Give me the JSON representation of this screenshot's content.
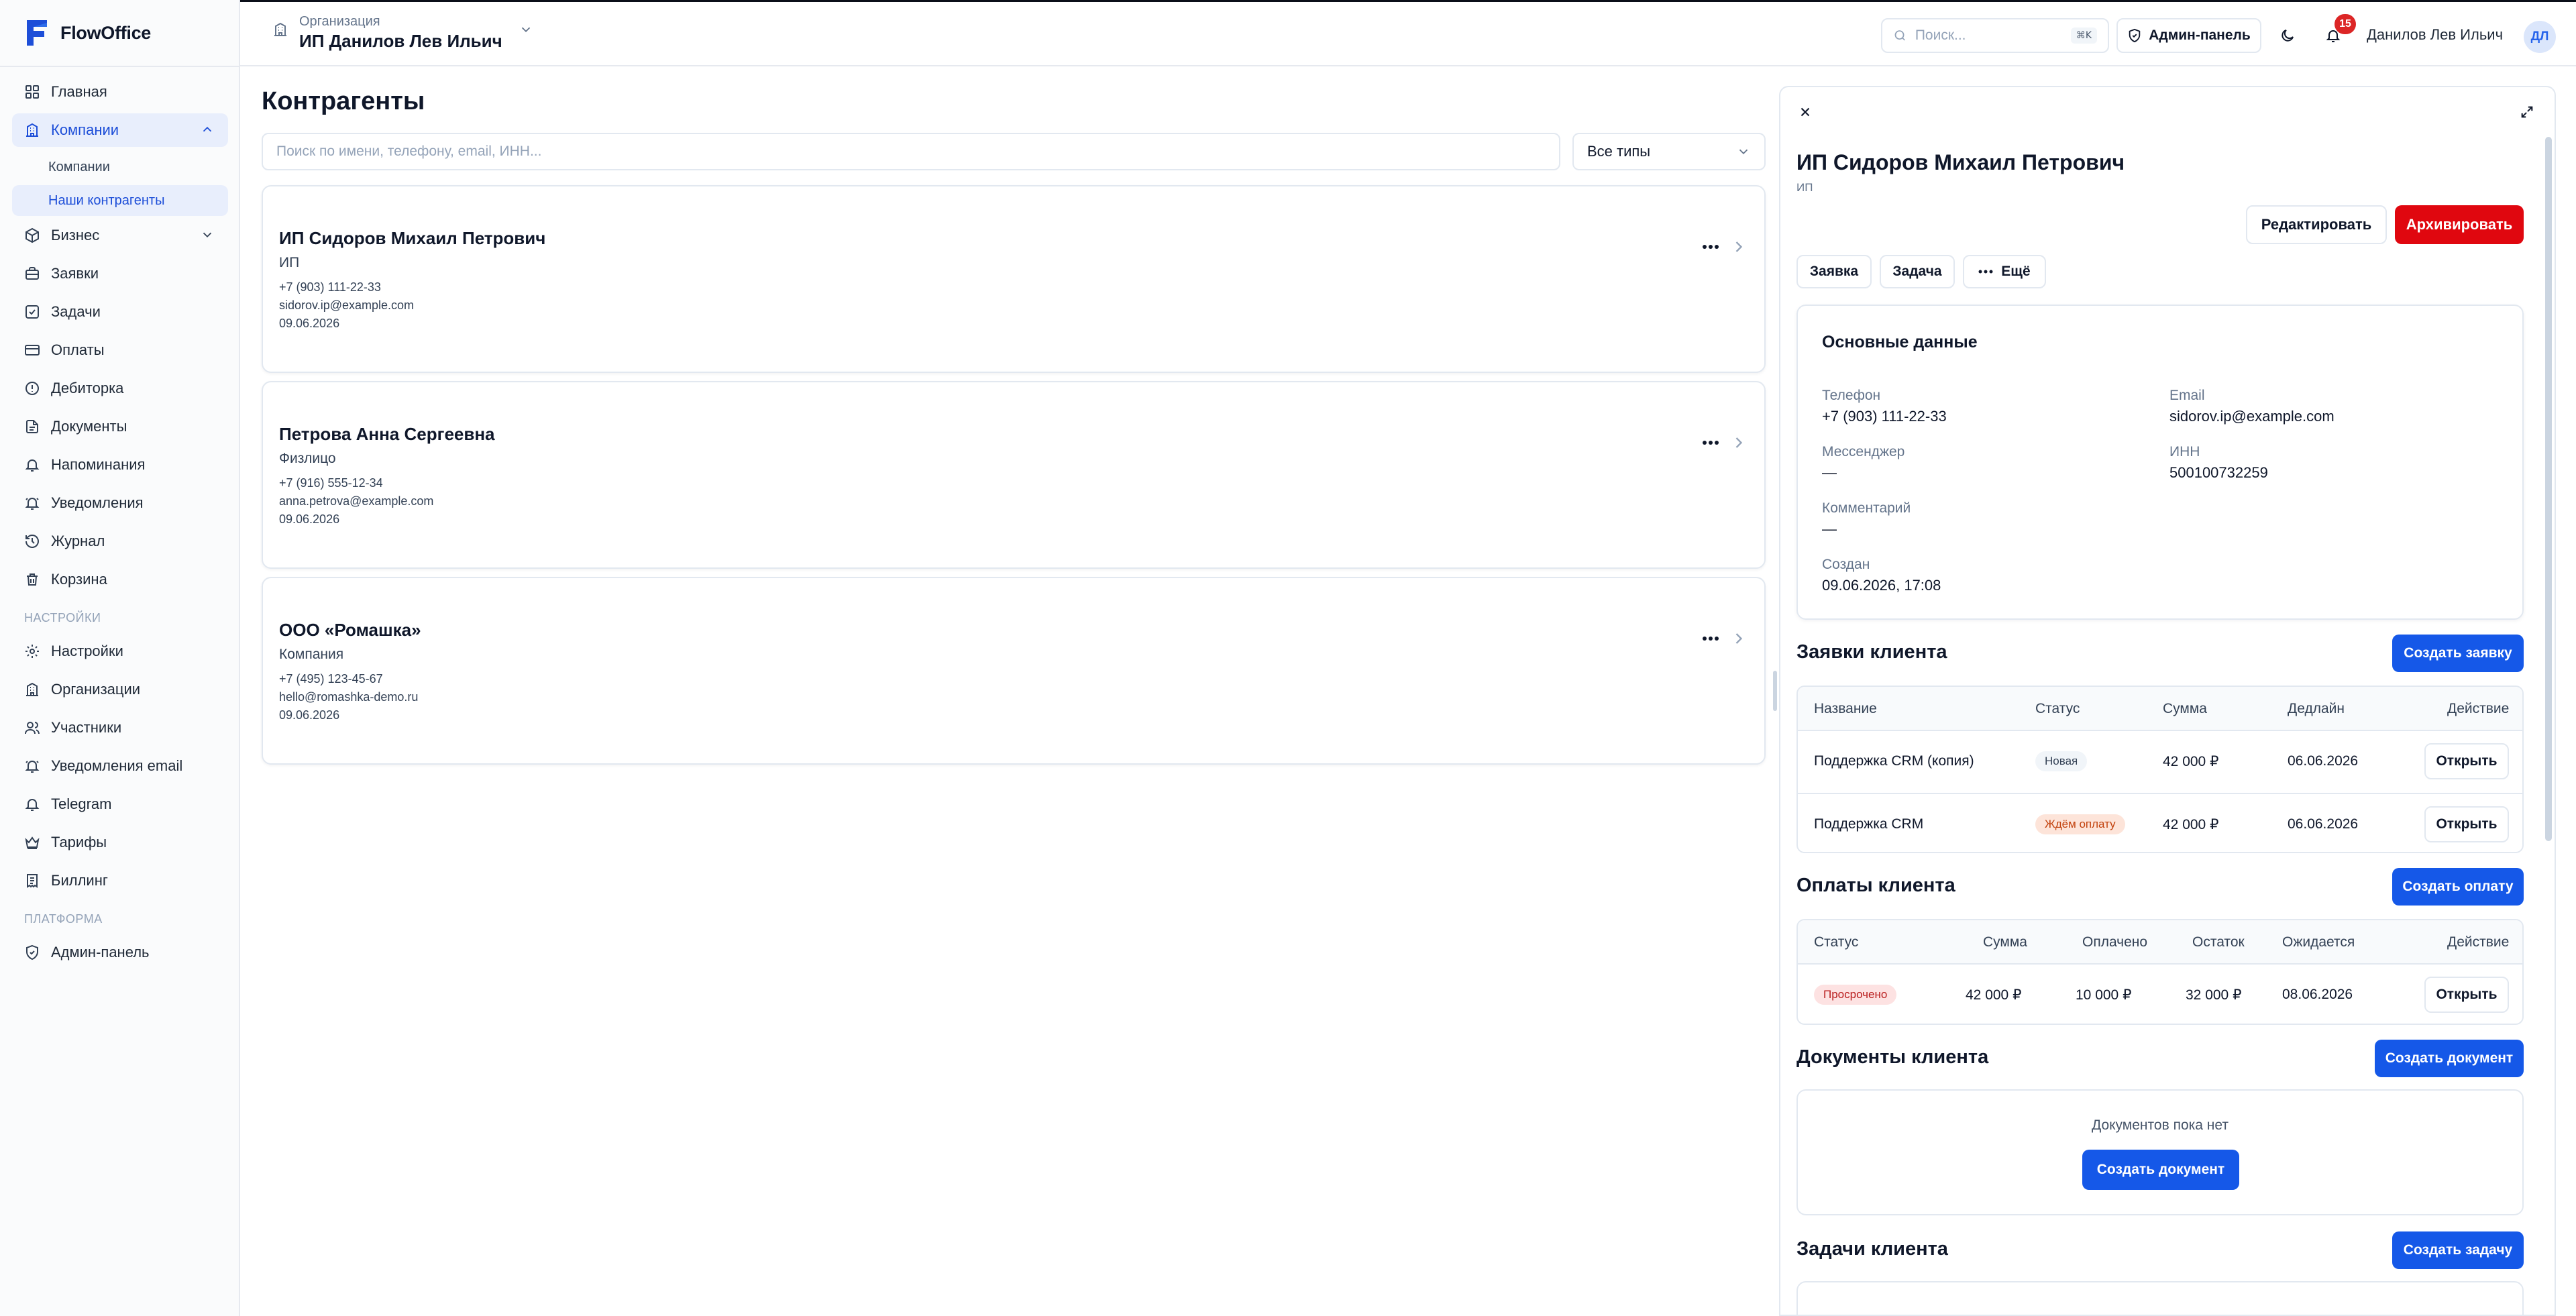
{
  "app": {
    "name": "FlowOffice"
  },
  "sidebar": {
    "items": [
      {
        "label": "Главная",
        "icon": "grid-icon"
      },
      {
        "label": "Компании",
        "icon": "building-icon"
      },
      {
        "label": "Бизнес",
        "icon": "box-icon"
      },
      {
        "label": "Заявки",
        "icon": "briefcase-icon"
      },
      {
        "label": "Задачи",
        "icon": "checkbox-icon"
      },
      {
        "label": "Оплаты",
        "icon": "card-icon"
      },
      {
        "label": "Дебиторка",
        "icon": "clock-alert-icon"
      },
      {
        "label": "Документы",
        "icon": "file-icon"
      },
      {
        "label": "Напоминания",
        "icon": "bell-icon"
      },
      {
        "label": "Уведомления",
        "icon": "bell-ring-icon"
      },
      {
        "label": "Журнал",
        "icon": "history-icon"
      },
      {
        "label": "Корзина",
        "icon": "trash-icon"
      }
    ],
    "sub_items": [
      "Компании",
      "Наши контрагенты"
    ],
    "settings_section": "НАСТРОЙКИ",
    "settings_items": [
      {
        "label": "Настройки",
        "icon": "gear-icon"
      },
      {
        "label": "Организации",
        "icon": "building-icon"
      },
      {
        "label": "Участники",
        "icon": "users-icon"
      },
      {
        "label": "Уведомления email",
        "icon": "bell-ring-icon"
      },
      {
        "label": "Telegram",
        "icon": "bell-icon"
      },
      {
        "label": "Тарифы",
        "icon": "crown-icon"
      },
      {
        "label": "Биллинг",
        "icon": "receipt-icon"
      }
    ],
    "platform_section": "ПЛАТФОРМА",
    "platform_items": [
      {
        "label": "Админ-панель",
        "icon": "shield-icon"
      }
    ]
  },
  "header": {
    "org_label": "Организация",
    "org_name": "ИП Данилов Лев Ильич",
    "search_placeholder": "Поиск...",
    "search_kbd": "⌘K",
    "admin_label": "Админ-панель",
    "notifications_count": "15",
    "user_name": "Данилов Лев Ильич",
    "user_initials": "ДЛ"
  },
  "main": {
    "title": "Контрагенты",
    "search_placeholder": "Поиск по имени, телефону, email, ИНН...",
    "type_filter": "Все типы",
    "cards": [
      {
        "name": "ИП Сидоров Михаил Петрович",
        "type": "ИП",
        "phone": "+7 (903) 111-22-33",
        "email": "sidorov.ip@example.com",
        "date": "09.06.2026"
      },
      {
        "name": "Петрова Анна Сергеевна",
        "type": "Физлицо",
        "phone": "+7 (916) 555-12-34",
        "email": "anna.petrova@example.com",
        "date": "09.06.2026"
      },
      {
        "name": "ООО «Ромашка»",
        "type": "Компания",
        "phone": "+7 (495) 123-45-67",
        "email": "hello@romashka-demo.ru",
        "date": "09.06.2026"
      }
    ]
  },
  "panel": {
    "title": "ИП Сидоров Михаил Петрович",
    "subtitle": "ИП",
    "edit_label": "Редактировать",
    "archive_label": "Архивировать",
    "quick": [
      "Заявка",
      "Задача",
      "Ещё"
    ],
    "info": {
      "title": "Основные данные",
      "phone_label": "Телефон",
      "phone": "+7 (903) 111-22-33",
      "email_label": "Email",
      "email": "sidorov.ip@example.com",
      "messenger_label": "Мессенджер",
      "messenger": "—",
      "inn_label": "ИНН",
      "inn": "500100732259",
      "comment_label": "Комментарий",
      "comment": "—",
      "created_label": "Создан",
      "created": "09.06.2026, 17:08"
    },
    "requests": {
      "title": "Заявки клиента",
      "create_label": "Создать заявку",
      "columns": [
        "Название",
        "Статус",
        "Сумма",
        "Дедлайн",
        "Действие"
      ],
      "rows": [
        {
          "name": "Поддержка CRM (копия)",
          "status": "Новая",
          "sum": "42 000 ₽",
          "deadline": "06.06.2026",
          "action": "Открыть"
        },
        {
          "name": "Поддержка CRM",
          "status": "Ждём оплату",
          "sum": "42 000 ₽",
          "deadline": "06.06.2026",
          "action": "Открыть"
        }
      ]
    },
    "payments": {
      "title": "Оплаты клиента",
      "create_label": "Создать оплату",
      "columns": [
        "Статус",
        "Сумма",
        "Оплачено",
        "Остаток",
        "Ожидается",
        "Действие"
      ],
      "rows": [
        {
          "status": "Просрочено",
          "sum": "42 000 ₽",
          "paid": "10 000 ₽",
          "rest": "32 000 ₽",
          "expected": "08.06.2026",
          "action": "Открыть"
        }
      ]
    },
    "documents": {
      "title": "Документы клиента",
      "create_label": "Создать документ",
      "empty_text": "Документов пока нет",
      "empty_create_label": "Создать документ"
    },
    "tasks": {
      "title": "Задачи клиента",
      "create_label": "Создать задачу"
    }
  },
  "colors": {
    "accent": "#1558e8",
    "danger": "#e0070f",
    "active_bg": "#e8eefc"
  }
}
